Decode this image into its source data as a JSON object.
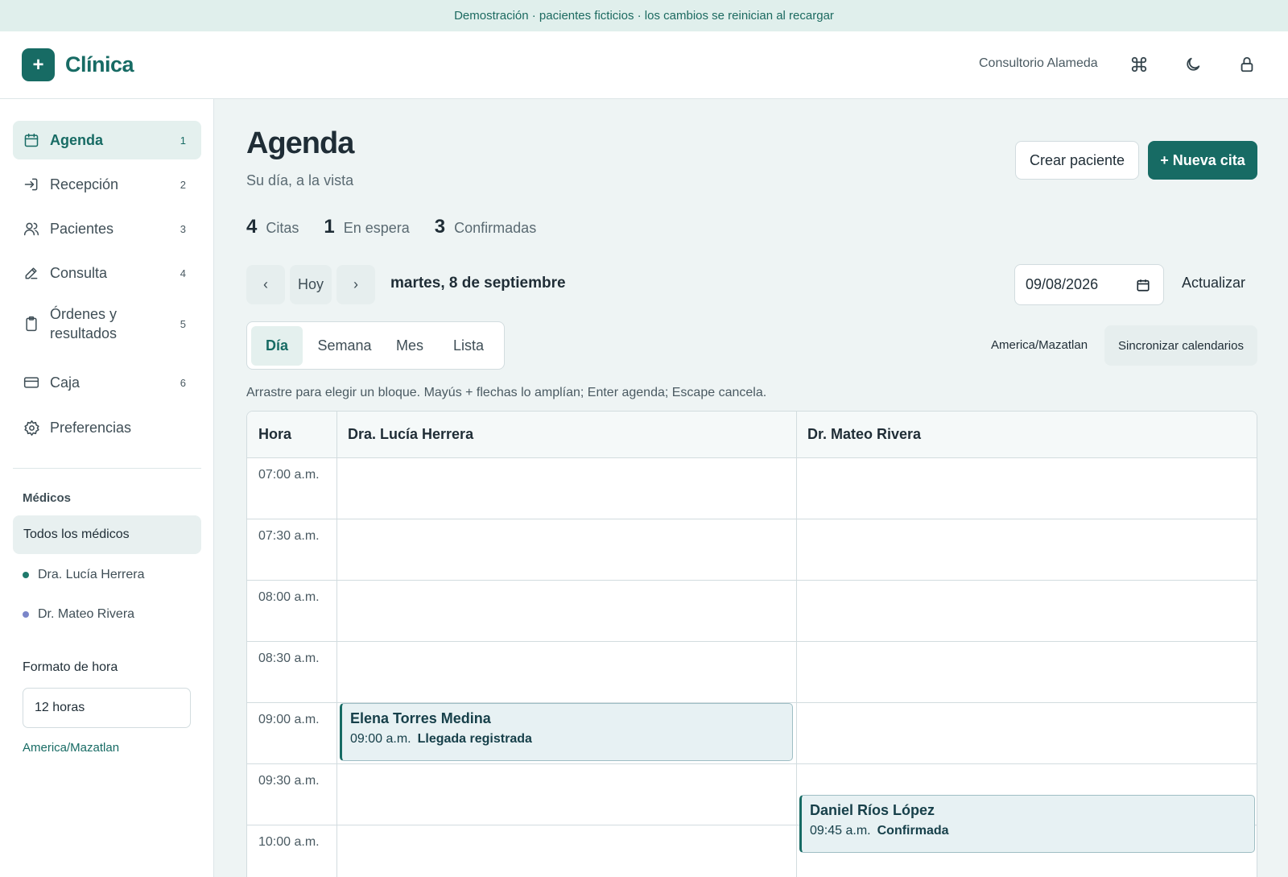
{
  "banner": "Demostración · pacientes ficticios · los cambios se reinician al recargar",
  "brand": {
    "mark": "+",
    "name": "Clínica"
  },
  "header": {
    "clinic": "Consultorio Alameda",
    "icons": [
      "command-icon",
      "moon-icon",
      "lock-icon"
    ]
  },
  "sidebar": {
    "items": [
      {
        "label": "Agenda",
        "num": "1",
        "icon": "calendar-icon",
        "active": true
      },
      {
        "label": "Recepción",
        "num": "2",
        "icon": "sign-in-icon"
      },
      {
        "label": "Pacientes",
        "num": "3",
        "icon": "users-icon"
      },
      {
        "label": "Consulta",
        "num": "4",
        "icon": "pencil-icon"
      },
      {
        "label": "Órdenes y resultados",
        "num": "5",
        "icon": "clipboard-icon"
      },
      {
        "label": "Caja",
        "num": "6",
        "icon": "credit-card-icon"
      },
      {
        "label": "Preferencias",
        "num": "",
        "icon": "gear-icon"
      }
    ],
    "doctors_heading": "Médicos",
    "all_doctors": "Todos los médicos",
    "doctors": [
      {
        "name": "Dra. Lucía Herrera",
        "color": "#1f7a6c"
      },
      {
        "name": "Dr. Mateo Rivera",
        "color": "#7b86c9"
      }
    ],
    "time_format_label": "Formato de hora",
    "time_format_value": "12 horas",
    "timezone": "America/Mazatlan"
  },
  "page": {
    "title": "Agenda",
    "subtitle": "Su día, a la vista",
    "create_patient": "Crear paciente",
    "new_appointment": "+ Nueva cita"
  },
  "stats": [
    {
      "n": "4",
      "label": "Citas"
    },
    {
      "n": "1",
      "label": "En espera"
    },
    {
      "n": "3",
      "label": "Confirmadas"
    }
  ],
  "datenav": {
    "prev": "‹",
    "today": "Hoy",
    "next": "›",
    "date_label": "martes, 8 de septiembre",
    "date_value": "09/08/2026",
    "refresh": "Actualizar"
  },
  "views": {
    "tabs": [
      "Día",
      "Semana",
      "Mes",
      "Lista"
    ],
    "active": "Día",
    "timezone": "America/Mazatlan",
    "sync": "Sincronizar calendarios"
  },
  "hint": "Arrastre para elegir un bloque. Mayús + flechas lo amplían; Enter agenda; Escape cancela.",
  "schedule": {
    "headers": [
      "Hora",
      "Dra. Lucía Herrera",
      "Dr. Mateo Rivera"
    ],
    "times": [
      "07:00 a.m.",
      "07:30 a.m.",
      "08:00 a.m.",
      "08:30 a.m.",
      "09:00 a.m.",
      "09:30 a.m.",
      "10:00 a.m."
    ],
    "appointments": [
      {
        "patient": "Elena Torres Medina",
        "time": "09:00 a.m.",
        "status": "Llegada registrada",
        "doctor": "Dra. Lucía Herrera"
      },
      {
        "patient": "Daniel Ríos López",
        "time": "09:45 a.m.",
        "status": "Confirmada",
        "doctor": "Dr. Mateo Rivera"
      }
    ]
  }
}
